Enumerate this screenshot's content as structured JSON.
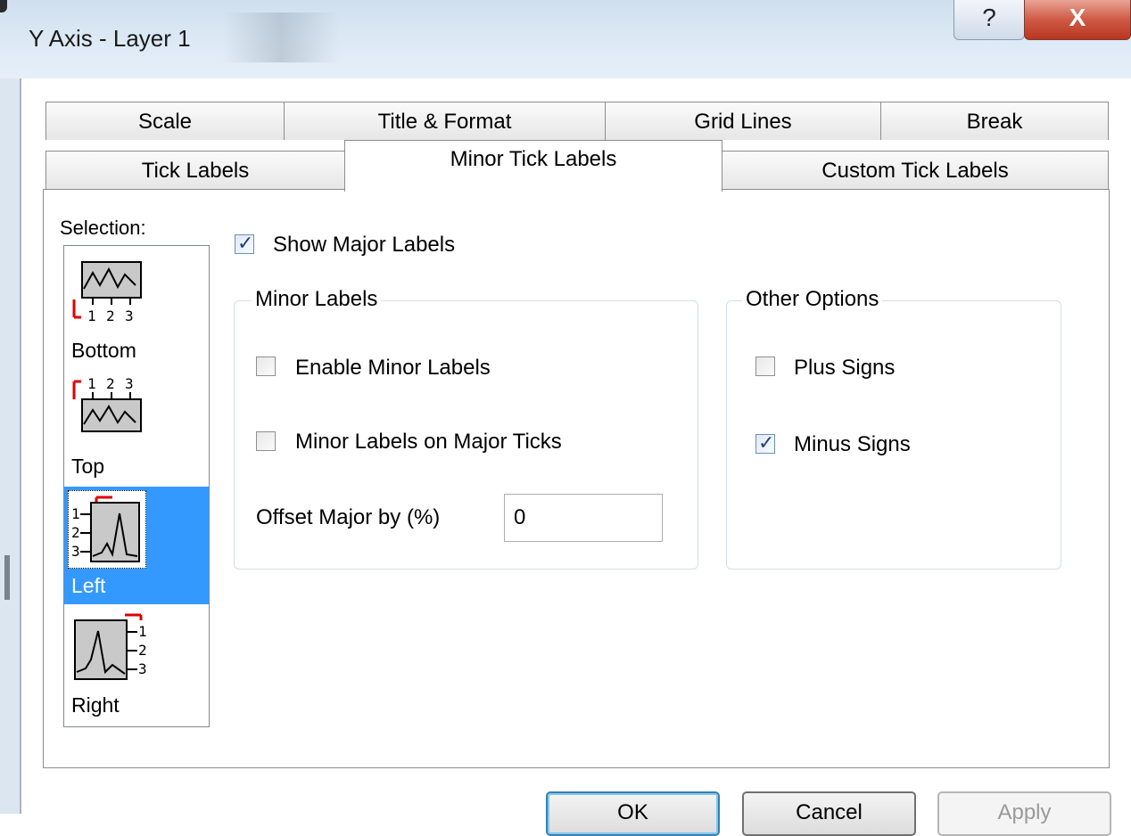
{
  "window": {
    "title": "Y Axis - Layer 1",
    "help_label": "?",
    "close_label": "X"
  },
  "tabs": {
    "row_back": [
      "Scale",
      "Title & Format",
      "Grid Lines",
      "Break"
    ],
    "row_front": [
      "Tick Labels",
      "Minor Tick Labels",
      "Custom Tick Labels"
    ],
    "active": "Minor Tick Labels"
  },
  "selection": {
    "label": "Selection:",
    "items": [
      {
        "label": "Bottom",
        "icon": "axis-bottom-icon",
        "selected": false,
        "tick_labels": [
          "1",
          "2",
          "3"
        ]
      },
      {
        "label": "Top",
        "icon": "axis-top-icon",
        "selected": false,
        "tick_labels": [
          "1",
          "2",
          "3"
        ]
      },
      {
        "label": "Left",
        "icon": "axis-left-icon",
        "selected": true,
        "tick_labels": [
          "1",
          "2",
          "3"
        ]
      },
      {
        "label": "Right",
        "icon": "axis-right-icon",
        "selected": false,
        "tick_labels": [
          "1",
          "2",
          "3"
        ]
      }
    ]
  },
  "show_major_labels": {
    "label": "Show Major Labels",
    "checked": true
  },
  "minor_labels": {
    "title": "Minor Labels",
    "enable": {
      "label": "Enable Minor Labels",
      "checked": false
    },
    "on_major": {
      "label": "Minor Labels on Major Ticks",
      "checked": false
    },
    "offset_label": "Offset Major by (%)",
    "offset_value": "0"
  },
  "other_options": {
    "title": "Other Options",
    "plus": {
      "label": "Plus Signs",
      "checked": false
    },
    "minus": {
      "label": "Minus Signs",
      "checked": true
    }
  },
  "buttons": {
    "ok": "OK",
    "cancel": "Cancel",
    "apply": "Apply"
  },
  "colors": {
    "selection_highlight": "#3399ff",
    "close_button": "#c9452f",
    "axis_marker": "#e00000"
  }
}
